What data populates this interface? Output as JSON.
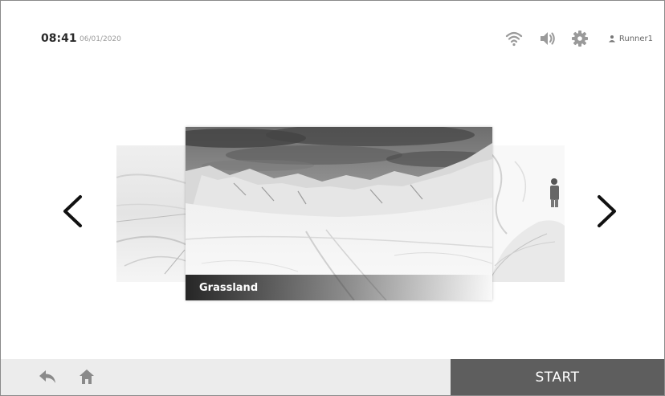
{
  "status": {
    "time": "08:41",
    "date": "06/01/2020",
    "username": "Runner1"
  },
  "icons": {
    "wifi": "wifi-icon",
    "volume": "volume-icon",
    "settings": "gear-icon",
    "user": "user-icon",
    "prev": "chevron-left-icon",
    "next": "chevron-right-icon",
    "back": "back-arrow-icon",
    "home": "home-icon"
  },
  "carousel": {
    "current": {
      "title": "Grassland"
    }
  },
  "actions": {
    "start_label": "START"
  },
  "colors": {
    "bottom_bar_left": "#ececec",
    "start_button": "#5e5e5e",
    "text_dark": "#2a2a2a",
    "icon_gray": "#9a9a9a"
  }
}
